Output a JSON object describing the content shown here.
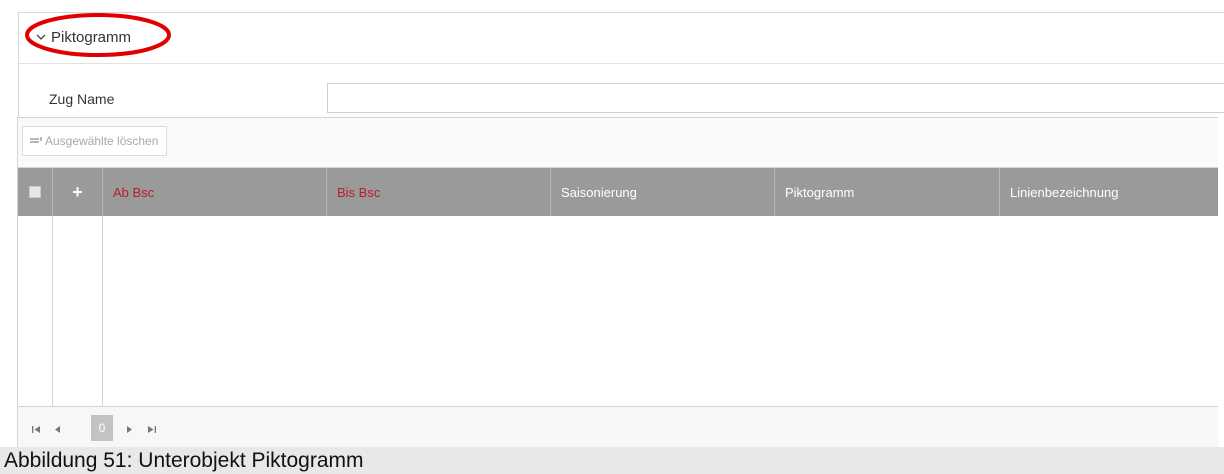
{
  "section": {
    "title": "Piktogramm",
    "expanded": true
  },
  "form": {
    "train_name_label": "Zug Name",
    "train_name_value": "",
    "train_name_placeholder": ""
  },
  "toolbar": {
    "delete_selected_label": "Ausgewählte löschen"
  },
  "grid": {
    "columns": [
      {
        "label": "Ab Bsc",
        "required": true
      },
      {
        "label": "Bis Bsc",
        "required": true
      },
      {
        "label": "Saisonierung",
        "required": false
      },
      {
        "label": "Piktogramm",
        "required": false
      },
      {
        "label": "Linienbezeichnung",
        "required": false
      }
    ],
    "rows": [],
    "add_glyph": "+"
  },
  "pager": {
    "current_page": "0"
  },
  "caption": "Abbildung 51: Unterobjekt Piktogramm",
  "colors": {
    "header_bg": "#9a9a9a",
    "required_text": "#b51f2e",
    "highlight": "#e00000"
  }
}
